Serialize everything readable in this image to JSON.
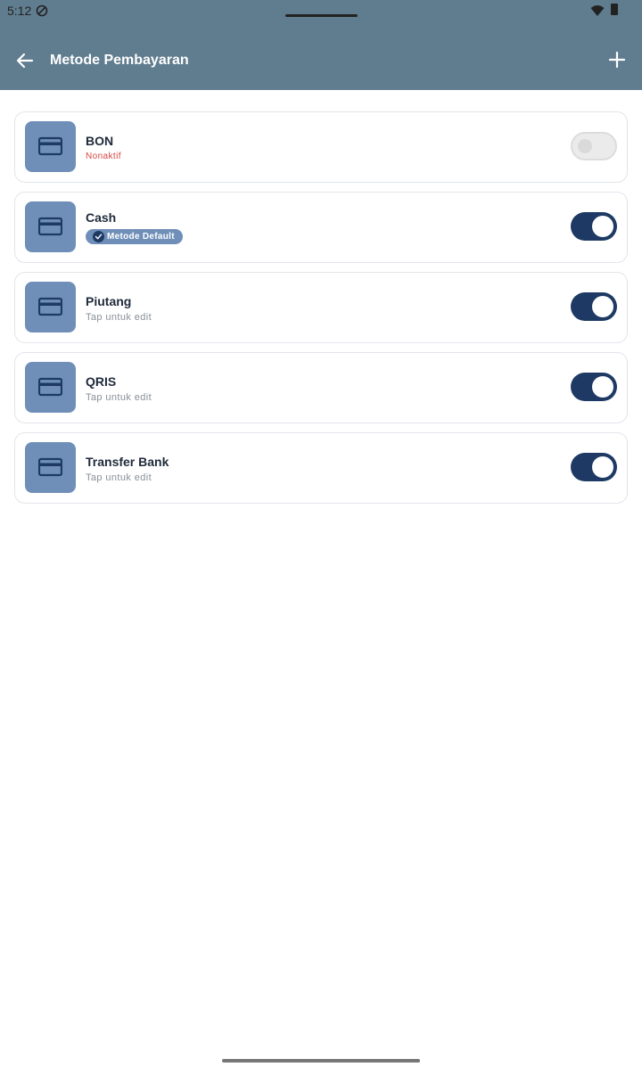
{
  "status_bar": {
    "time": "5:12",
    "icons": [
      "do-not-disturb-icon",
      "wifi-icon",
      "battery-icon"
    ]
  },
  "app_bar": {
    "title": "Metode Pembayaran",
    "back_icon": "arrow-left-icon",
    "add_icon": "plus-icon",
    "background_color": "#607d8f"
  },
  "payment_methods": [
    {
      "name": "BON",
      "subtitle": "Nonaktif",
      "enabled": false,
      "is_default": false
    },
    {
      "name": "Cash",
      "subtitle": "Metode Default",
      "enabled": true,
      "is_default": true
    },
    {
      "name": "Piutang",
      "subtitle": "Tap untuk edit",
      "enabled": true,
      "is_default": false
    },
    {
      "name": "QRIS",
      "subtitle": "Tap untuk edit",
      "enabled": true,
      "is_default": false
    },
    {
      "name": "Transfer Bank",
      "subtitle": "Tap untuk edit",
      "enabled": true,
      "is_default": false
    }
  ],
  "colors": {
    "accent": "#1e3a64",
    "icon_box": "#6f8fb8",
    "inactive_text": "#d64541"
  }
}
